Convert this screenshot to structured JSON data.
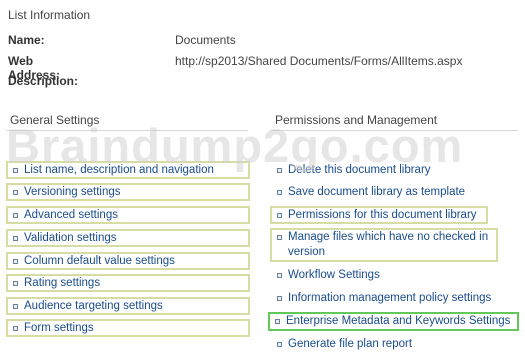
{
  "list_info": {
    "title": "List Information",
    "name_label": "Name:",
    "name_value": "Documents",
    "web_address_label": "Web Address:",
    "web_address_value": "http://sp2013/Shared Documents/Forms/AllItems.aspx",
    "description_label": "Description:"
  },
  "general_settings": {
    "heading": "General Settings",
    "items": [
      "List name, description and navigation",
      "Versioning settings",
      "Advanced settings",
      "Validation settings",
      "Column default value settings",
      "Rating settings",
      "Audience targeting settings",
      "Form settings"
    ]
  },
  "permissions": {
    "heading": "Permissions and Management",
    "items": [
      "Delete this document library",
      "Save document library as template",
      "Permissions for this document library",
      "Manage files which have no checked in version",
      "Workflow Settings",
      "Information management policy settings",
      "Enterprise Metadata and Keywords Settings",
      "Generate file plan report"
    ]
  },
  "watermark": "Braindump2go.com"
}
